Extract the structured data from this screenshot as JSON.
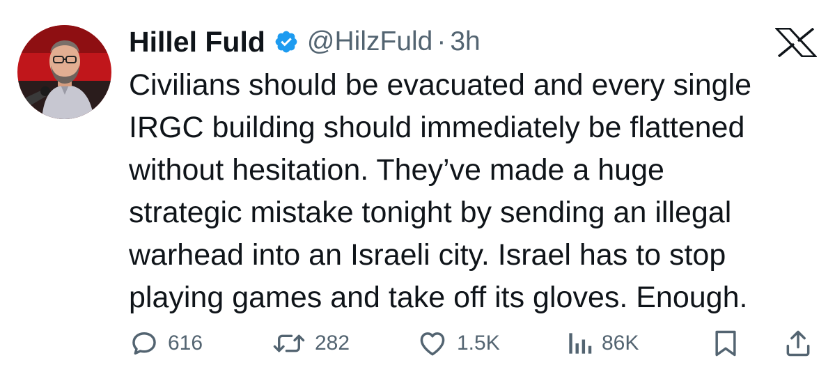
{
  "author": {
    "display_name": "Hillel Fuld",
    "handle": "@HilzFuld",
    "separator": "·",
    "time": "3h",
    "verified": true
  },
  "tweet": {
    "lines": [
      "Civilians should be evacuated and every single",
      "IRGC building should immediately be flattened",
      "without hesitation. They’ve made a huge",
      "strategic mistake tonight by sending an illegal",
      "warhead into an Israeli city. Israel has to stop",
      "playing games and take off its gloves. Enough."
    ]
  },
  "actions": {
    "replies": "616",
    "reposts": "282",
    "likes": "1.5K",
    "views": "86K"
  },
  "icons": {
    "reply": "reply-icon",
    "repost": "repost-icon",
    "like": "heart-icon",
    "views": "views-icon",
    "bookmark": "bookmark-icon",
    "share": "share-icon",
    "verified": "verified-badge-icon",
    "brand": "x-logo-icon"
  },
  "colors": {
    "text": "#0f1419",
    "secondary": "#536471",
    "verified": "#1d9bf0"
  }
}
